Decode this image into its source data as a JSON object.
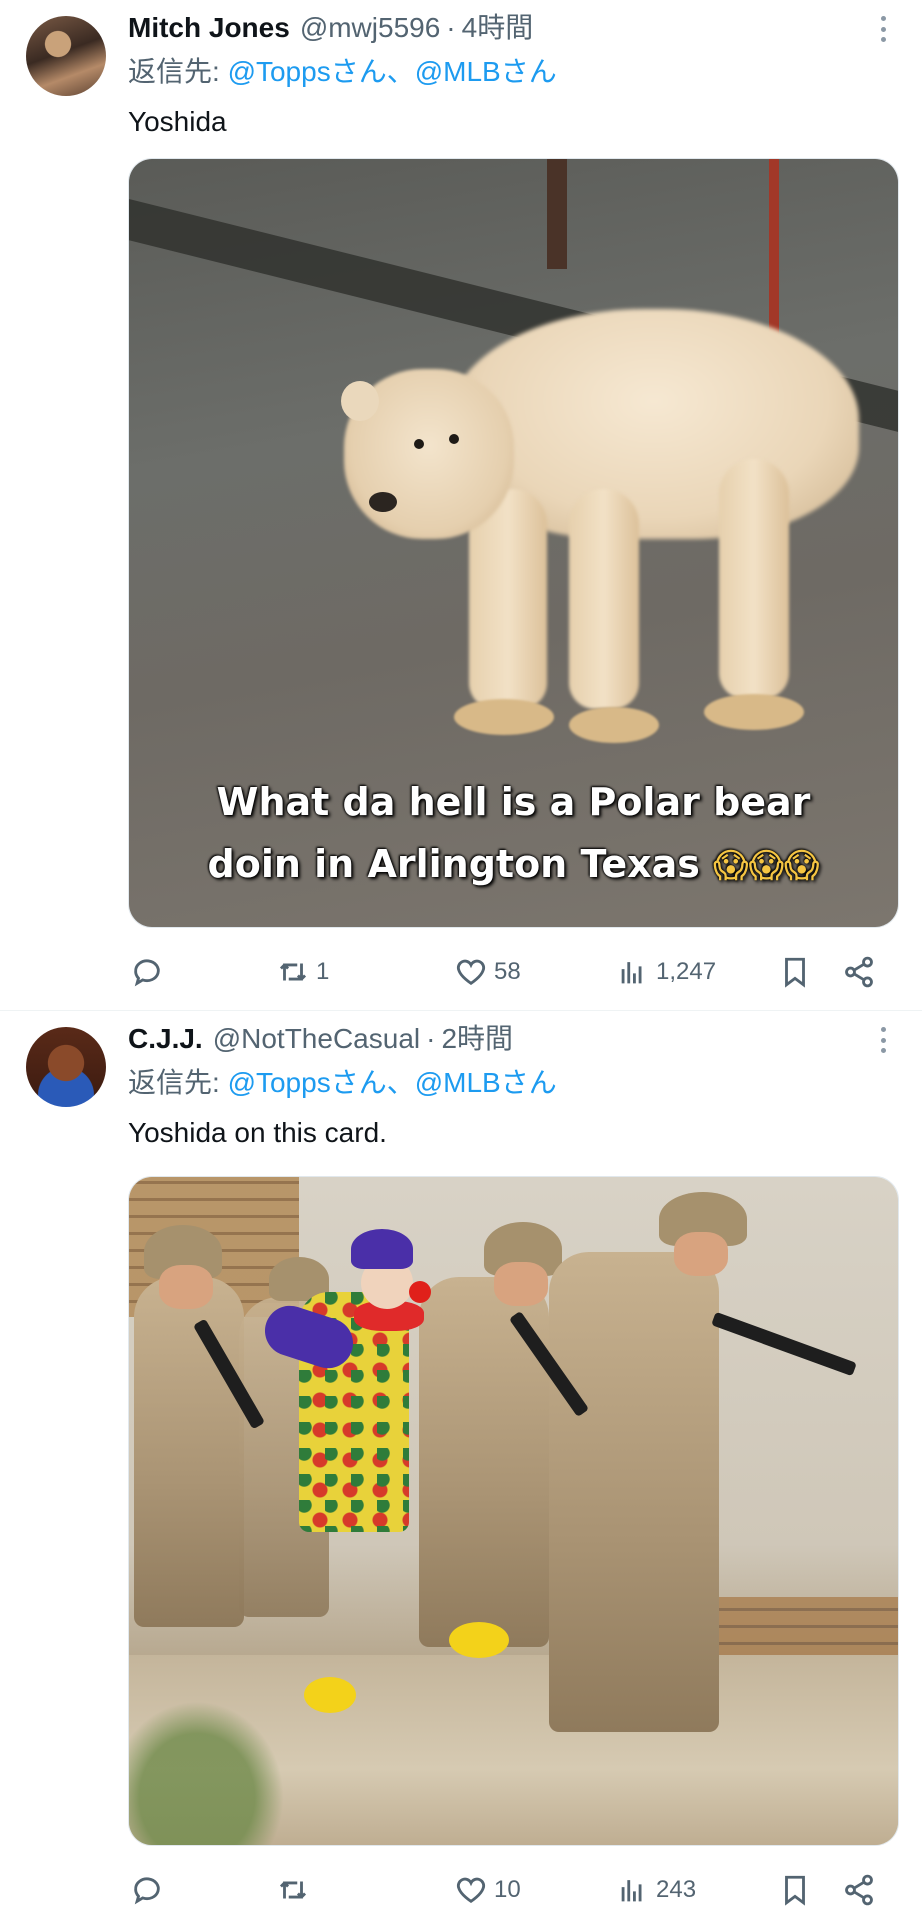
{
  "tweets": [
    {
      "name": "Mitch Jones",
      "handle": "@mwj5596",
      "separator": "·",
      "time": "4時間",
      "reply_prefix": "返信先: ",
      "reply_targets": "@Toppsさん、@MLBさん",
      "text": "Yoshida",
      "media_caption_line1": "What da hell is a Polar bear",
      "media_caption_line2": "doin in Arlington Texas",
      "media_caption_emoji": "😱😱😱",
      "stats": {
        "replies": "",
        "retweets": "1",
        "likes": "58",
        "views": "1,247"
      }
    },
    {
      "name": "C.J.J.",
      "handle": "@NotTheCasual",
      "separator": "·",
      "time": "2時間",
      "reply_prefix": "返信先: ",
      "reply_targets": "@Toppsさん、@MLBさん",
      "text": "Yoshida on this card.",
      "stats": {
        "replies": "",
        "retweets": "",
        "likes": "10",
        "views": "243"
      }
    }
  ],
  "icons": {
    "reply": "reply-icon",
    "retweet": "retweet-icon",
    "like": "heart-icon",
    "views": "views-icon",
    "bookmark": "bookmark-icon",
    "share": "share-icon",
    "more": "more-icon"
  },
  "colors": {
    "text": "#0f1419",
    "secondary": "#536471",
    "link": "#1d9bf0",
    "divider": "#eff3f4"
  }
}
